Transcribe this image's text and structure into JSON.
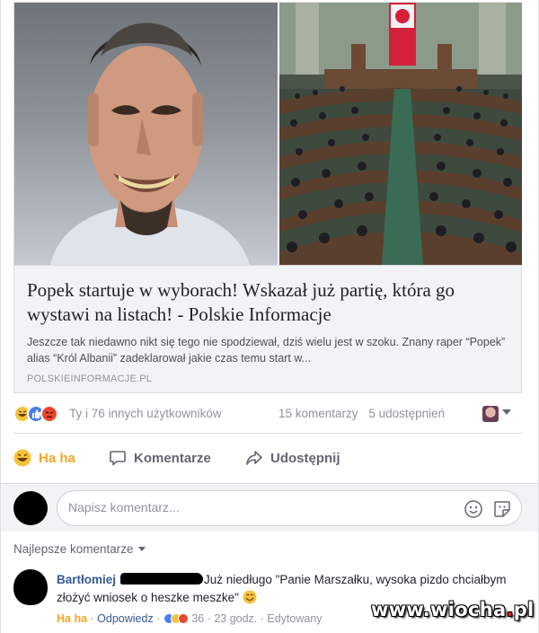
{
  "post": {
    "link_preview": {
      "headline": "Popek startuje w wyborach! Wskazał już partię, która go wystawi na listach! - Polskie Informacje",
      "description": "Jeszcze tak niedawno nikt się tego nie spodziewał, dziś wielu jest w szoku. Znany raper “Popek” alias “Król Albanii” zadeklarował jakie czas temu start w...",
      "domain": "POLSKIEINFORMACJE.PL",
      "image_left": "rapper-portrait",
      "image_right": "parliament-chamber"
    },
    "stats": {
      "reaction_icons": [
        "haha-icon",
        "like-icon",
        "angry-icon"
      ],
      "likers_text": "Ty i 76 innych użytkowników",
      "comments_count_text": "15 komentarzy",
      "shares_count_text": "5 udostępnień"
    },
    "actions": {
      "react_label": "Ha ha",
      "comment_label": "Komentarze",
      "share_label": "Udostępnij"
    }
  },
  "composer": {
    "placeholder": "Napisz komentarz..."
  },
  "comments": {
    "filter_label": "Najlepsze komentarze",
    "items": [
      {
        "author": "Bartłomiej",
        "text": "Już niedługo \"Panie Marszałku, wysoka pizdo chciałbym złożyć wniosek o heszke meszke\"",
        "react_label": "Ha ha",
        "reply_label": "Odpowiedz",
        "reaction_count": "36",
        "time": "23 godz.",
        "edited_label": "Edytowany"
      }
    ]
  },
  "watermark": {
    "text_a": "www.wiocha",
    "dot": ".",
    "text_b": "pl"
  },
  "colors": {
    "link_blue": "#385898",
    "haha_yellow": "#f5a623",
    "meta_gray": "#90949c"
  }
}
